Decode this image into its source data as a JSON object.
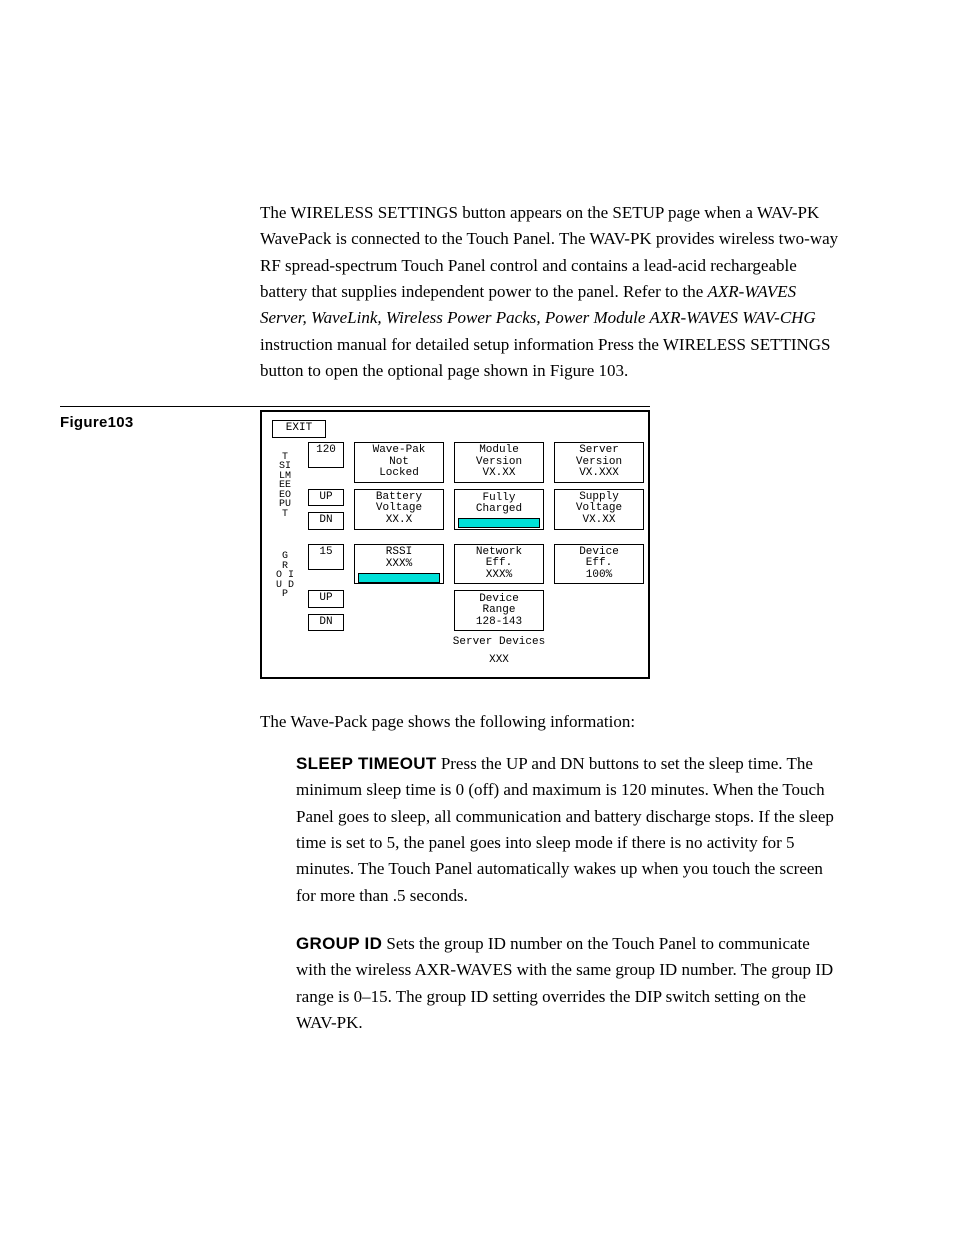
{
  "intro": {
    "text_a": "The WIRELESS SETTINGS button appears on the SETUP page when a WAV-PK WavePack is connected to the Touch Panel. The WAV-PK provides wireless two-way RF spread-spectrum Touch Panel control and contains a lead-acid rechargeable battery that supplies independent power to the panel. Refer to the ",
    "ital": "AXR-WAVES Server, WaveLink, Wireless Power Packs, Power Module AXR-WAVES WAV-CHG",
    "text_b": " instruction manual for detailed setup information Press the WIRELESS SETTINGS button to open the optional page shown in Figure 103."
  },
  "figure": {
    "label": "Figure103",
    "exit": "EXIT",
    "sleep": {
      "vlabel": [
        "  T",
        "SI",
        "LM",
        "EE",
        "EO",
        "PU",
        " T"
      ],
      "val": "120",
      "up": "UP",
      "dn": "DN"
    },
    "group": {
      "vlabel": [
        "G",
        "R",
        "O I",
        "U D",
        "P"
      ],
      "val": "15",
      "up": "UP",
      "dn": "DN"
    },
    "c1": {
      "wavepak": [
        "Wave-Pak",
        "Not",
        "Locked"
      ],
      "battery": [
        "Battery",
        "Voltage",
        "XX.X"
      ],
      "rssi": [
        "RSSI",
        "XXX%"
      ]
    },
    "c2": {
      "module": [
        "Module",
        "Version",
        "VX.XX"
      ],
      "charged": [
        "Fully",
        "Charged"
      ],
      "netw": [
        "Network",
        "Eff.",
        "XXX%"
      ],
      "range": [
        "Device",
        "Range",
        "128-143"
      ]
    },
    "c3": {
      "server": [
        "Server",
        "Version",
        "VX.XXX"
      ],
      "supply": [
        "Supply",
        "Voltage",
        "VX.XX"
      ],
      "deveff": [
        "Device",
        "Eff.",
        "100%"
      ]
    },
    "srv_dev_label": "Server Devices",
    "srv_dev_val": "XXX"
  },
  "after_fig": "The Wave-Pack page shows the following information:",
  "sleep_def": {
    "head": "SLEEP TIMEOUT",
    "body": "  Press the UP and DN buttons to set the sleep time. The minimum sleep time is 0 (off) and maximum is 120 minutes. When the Touch Panel goes to sleep, all communication and battery discharge stops. If the sleep time is set to 5, the panel goes into sleep mode if there is no activity for 5 minutes. The Touch Panel automatically wakes up when you touch the screen for more than .5 seconds."
  },
  "group_def": {
    "head": "GROUP ID",
    "body": "    Sets the group ID number on the Touch Panel to communicate with the wireless AXR-WAVES with the same group ID number. The group ID range is 0–15. The group ID setting overrides the DIP switch setting on the WAV-PK."
  }
}
